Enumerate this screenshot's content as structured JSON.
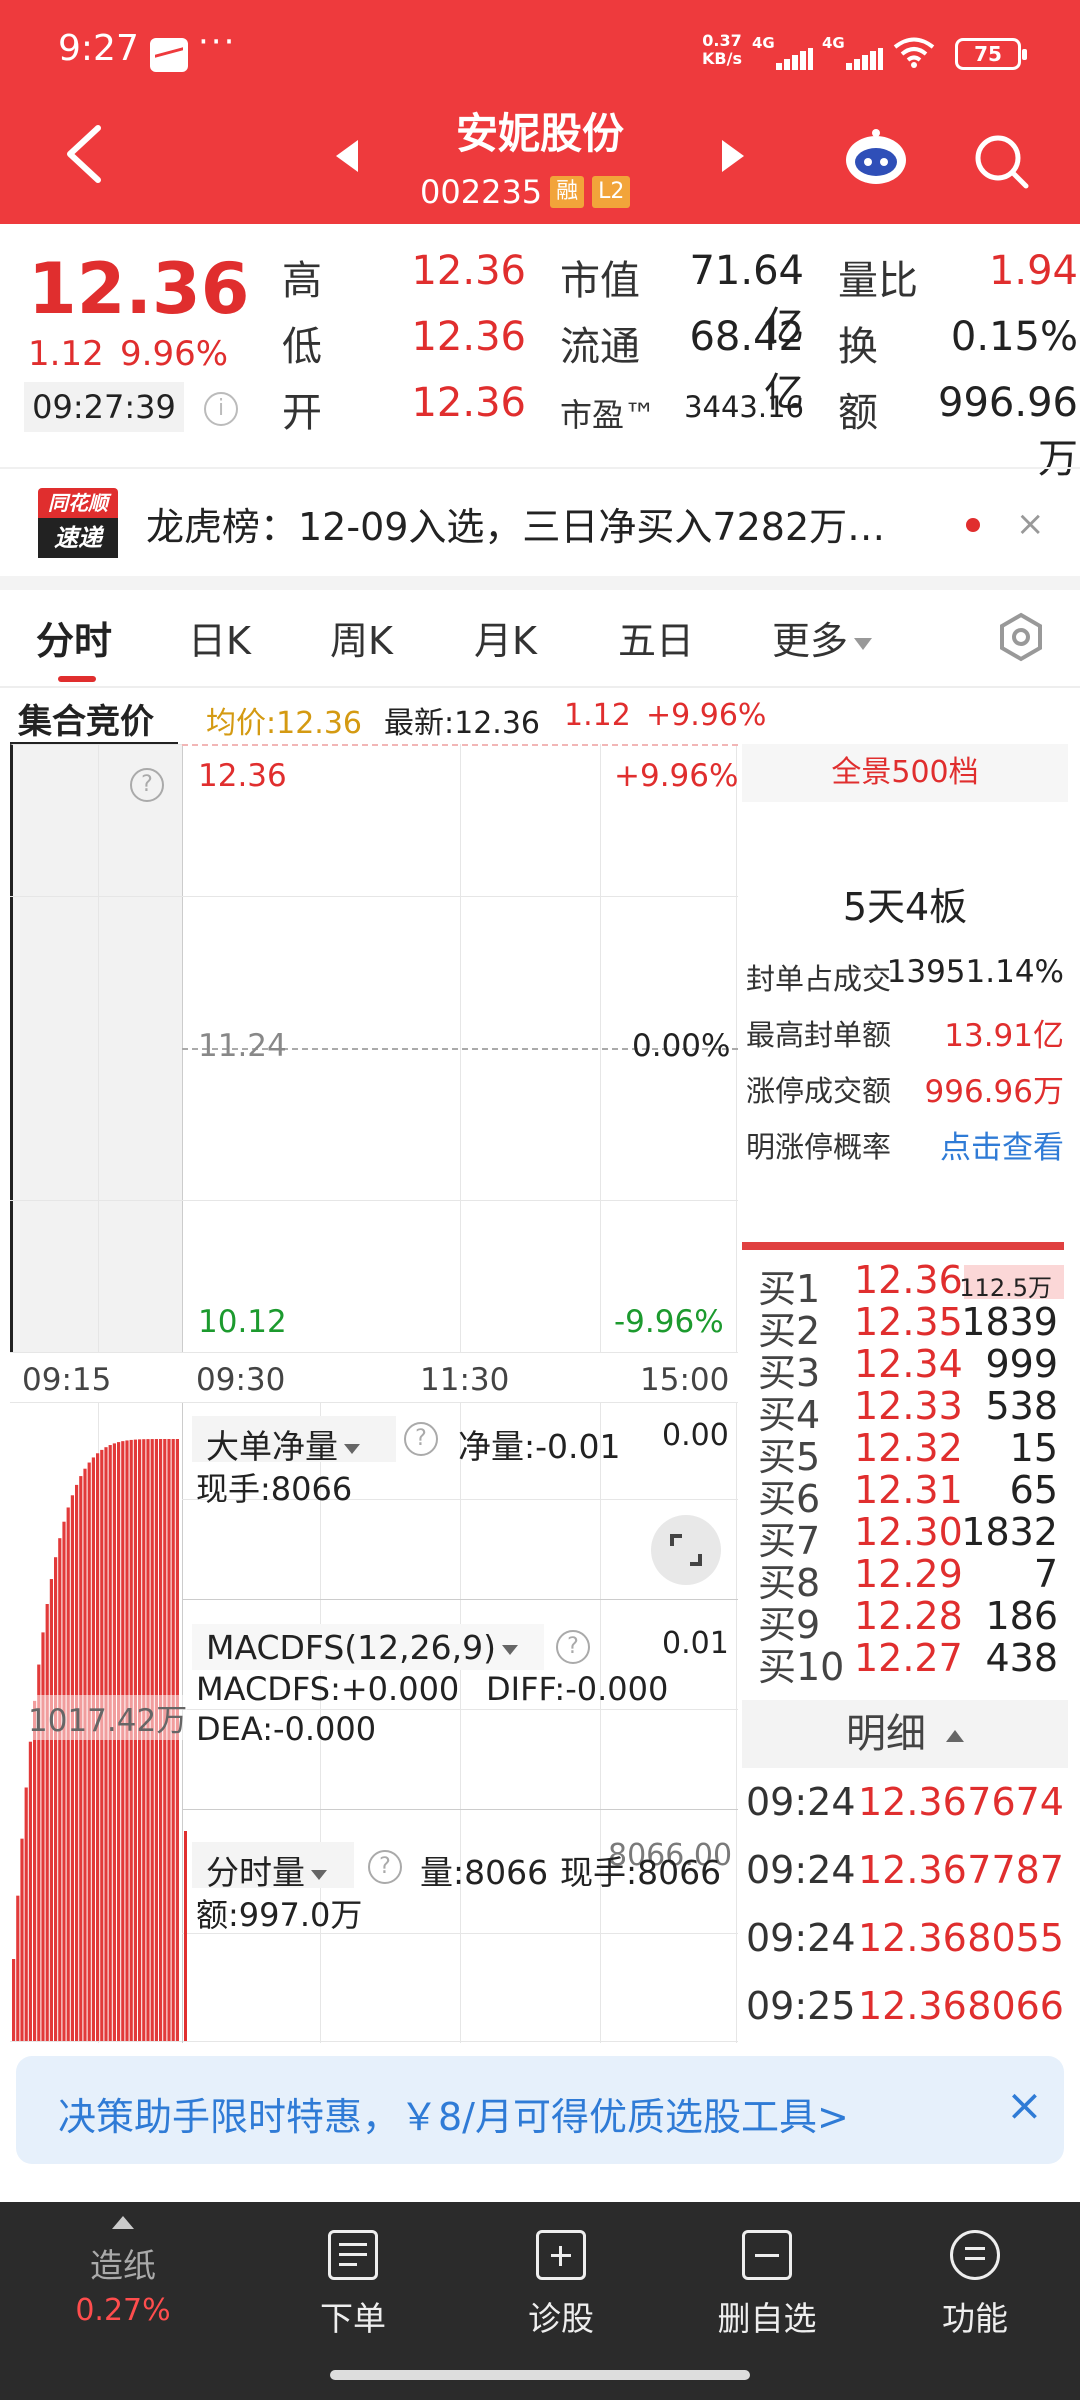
{
  "status": {
    "time": "9:27",
    "dots": "···",
    "speed_top": "0.37",
    "speed_bottom": "KB/s",
    "sig1": "4G",
    "sig2": "4G",
    "battery": "75"
  },
  "header": {
    "stock_name": "安妮股份",
    "stock_code": "002235",
    "tag_margin": "融",
    "tag_level": "L2"
  },
  "quote": {
    "price": "12.36",
    "change": "1.12",
    "change_pct": "9.96%",
    "time": "09:27:39",
    "info": "i",
    "high_label": "高",
    "high": "12.36",
    "low_label": "低",
    "low": "12.36",
    "open_label": "开",
    "open": "12.36",
    "mcap_label": "市值",
    "mcap": "71.64亿",
    "float_label": "流通",
    "float": "68.42亿",
    "pe_label": "市盈™",
    "pe": "3443.16",
    "vol_ratio_label": "量比",
    "vol_ratio": "1.94",
    "turnover_label": "换",
    "turnover": "0.15%",
    "amount_label": "额",
    "amount": "996.96万"
  },
  "dragon": {
    "logo_top": "同花顺",
    "logo_bottom": "速递",
    "text": "龙虎榜：12-09入选，三日净买入7282万…",
    "close": "×"
  },
  "tabs": [
    "分时",
    "日K",
    "周K",
    "月K",
    "五日",
    "更多"
  ],
  "chart_header": {
    "auction": "集合竞价",
    "avg": "均价:12.36",
    "latest": "最新:12.36",
    "change": "1.12",
    "pct": "+9.96%"
  },
  "chart_axis": {
    "top_price": "12.36",
    "top_pct": "+9.96%",
    "mid_price": "11.24",
    "mid_pct": "0.00%",
    "bottom_price": "10.12",
    "bottom_pct": "-9.96%",
    "t0": "09:15",
    "t1": "09:30",
    "t2": "11:30",
    "t3": "15:00",
    "qmark": "?"
  },
  "auction_volume": "1017.42万",
  "panes": {
    "big_order": {
      "title": "大单净量",
      "net": "净量:-0.01",
      "scale": "0.00",
      "hand": "现手:8066"
    },
    "macd": {
      "title": "MACDFS(12,26,9)",
      "scale": "0.01",
      "macdfs": "MACDFS:+0.000",
      "diff": "DIFF:-0.000",
      "dea": "DEA:-0.000"
    },
    "vol": {
      "title": "分时量",
      "vol": "量:8066",
      "hand": "现手:8066",
      "scale": "8066.00",
      "amount": "额:997.0万"
    }
  },
  "book": {
    "panorama": "全景500档",
    "board": "5天4板",
    "summary": [
      {
        "label": "封单占成交",
        "value": "13951.14%",
        "color": "#222222"
      },
      {
        "label": "最高封单额",
        "value": "13.91亿",
        "color": "#e02e2e"
      },
      {
        "label": "涨停成交额",
        "value": "996.96万",
        "color": "#e02e2e"
      },
      {
        "label": "明涨停概率",
        "value": "点击查看",
        "color": "#2f7bd6"
      }
    ],
    "bids": [
      {
        "label": "买1",
        "price": "12.36",
        "vol": "112.5万"
      },
      {
        "label": "买2",
        "price": "12.35",
        "vol": "1839"
      },
      {
        "label": "买3",
        "price": "12.34",
        "vol": "999"
      },
      {
        "label": "买4",
        "price": "12.33",
        "vol": "538"
      },
      {
        "label": "买5",
        "price": "12.32",
        "vol": "15"
      },
      {
        "label": "买6",
        "price": "12.31",
        "vol": "65"
      },
      {
        "label": "买7",
        "price": "12.30",
        "vol": "1832"
      },
      {
        "label": "买8",
        "price": "12.29",
        "vol": "7"
      },
      {
        "label": "买9",
        "price": "12.28",
        "vol": "186"
      },
      {
        "label": "买10",
        "price": "12.27",
        "vol": "438"
      }
    ],
    "detail_title": "明细",
    "details": [
      {
        "time": "09:24",
        "price": "12.36",
        "vol": "7674"
      },
      {
        "time": "09:24",
        "price": "12.36",
        "vol": "7787"
      },
      {
        "time": "09:24",
        "price": "12.36",
        "vol": "8055"
      },
      {
        "time": "09:25",
        "price": "12.36",
        "vol": "8066"
      }
    ]
  },
  "promo": {
    "text": "决策助手限时特惠，￥8/月可得优质选股工具>",
    "close": "×"
  },
  "bottom_bar": [
    {
      "label": "造纸",
      "sub": "0.27%"
    },
    {
      "label": "下单"
    },
    {
      "label": "诊股"
    },
    {
      "label": "删自选"
    },
    {
      "label": "功能"
    }
  ],
  "colors": {
    "brand_red": "#ee3a3d",
    "up_red": "#e02e2e",
    "down_green": "#1c9a2e",
    "avg_gold": "#d49a12",
    "link_blue": "#2f7bd6"
  }
}
